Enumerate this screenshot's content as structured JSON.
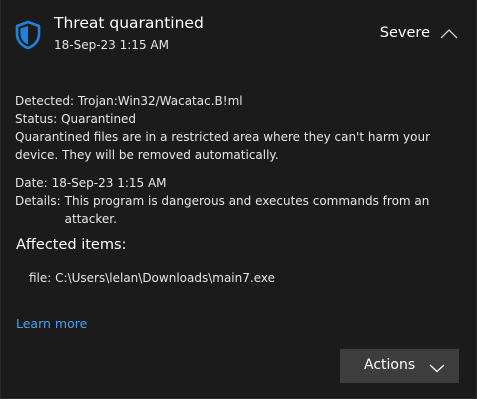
{
  "notification": {
    "title": "Threat quarantined",
    "timestamp": "18-Sep-23 1:15 AM",
    "severity": "Severe",
    "icons": {
      "status": "shield-icon",
      "collapse": "chevron-up-icon",
      "actions": "chevron-down-icon"
    }
  },
  "details": {
    "detected_label": "Detected:",
    "detected_value": "Trojan:Win32/Wacatac.B!ml",
    "status_label": "Status:",
    "status_value": "Quarantined",
    "status_description": "Quarantined files are in a restricted area where they can't harm your device. They will be removed automatically.",
    "date_label": "Date:",
    "date_value": "18-Sep-23 1:15 AM",
    "details_label": "Details:",
    "details_value": "This program is dangerous and executes commands from an attacker."
  },
  "affected": {
    "heading": "Affected items:",
    "items": [
      {
        "type": "file:",
        "path": "C:\\Users\\lelan\\Downloads\\main7.exe"
      }
    ]
  },
  "links": {
    "learn_more": "Learn more"
  },
  "actions": {
    "label": "Actions"
  },
  "colors": {
    "background": "#1b1b1b",
    "accent": "#4aa0ee",
    "shield": "#1f82e0",
    "button": "#3d3d3d"
  }
}
